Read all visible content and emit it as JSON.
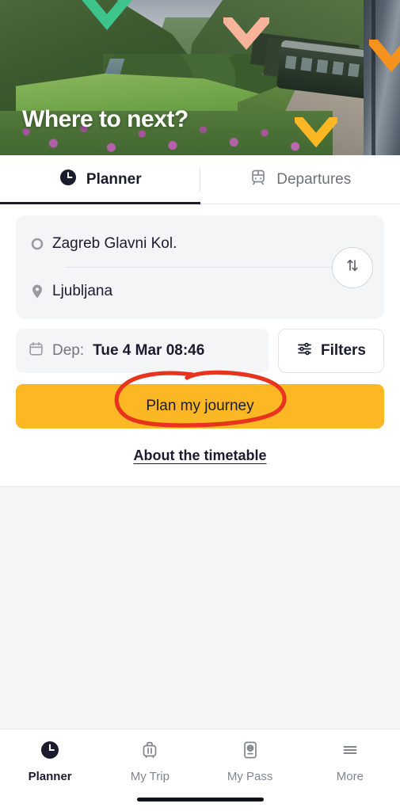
{
  "hero": {
    "title": "Where to next?",
    "chevrons": [
      {
        "name": "chevron-green",
        "color": "#3DC48A"
      },
      {
        "name": "chevron-salmon",
        "color": "#F7B49B"
      },
      {
        "name": "chevron-orange",
        "color": "#F6921E"
      },
      {
        "name": "chevron-yellow",
        "color": "#FBB724"
      }
    ]
  },
  "tabs": {
    "planner": {
      "label": "Planner",
      "icon": "clock-icon",
      "active": true
    },
    "departures": {
      "label": "Departures",
      "icon": "train-icon",
      "active": false
    }
  },
  "planner": {
    "origin": {
      "value": "Zagreb Glavni Kol.",
      "icon": "circle-origin-icon"
    },
    "destination": {
      "value": "Ljubljana",
      "icon": "map-pin-icon"
    },
    "swap": {
      "icon": "swap-vertical-icon"
    },
    "date": {
      "prefix": "Dep:",
      "value": "Tue 4 Mar 08:46",
      "icon": "calendar-icon"
    },
    "filters": {
      "label": "Filters",
      "icon": "sliders-icon"
    },
    "cta": {
      "label": "Plan my journey",
      "color": "#FBB724"
    },
    "about_link": {
      "label": "About the timetable"
    }
  },
  "annotation": {
    "shape": "hand-drawn-ellipse",
    "color": "#E8341F",
    "target": "Plan my journey"
  },
  "bottom_nav": [
    {
      "label": "Planner",
      "icon": "clock-icon",
      "active": true
    },
    {
      "label": "My Trip",
      "icon": "suitcase-icon",
      "active": false
    },
    {
      "label": "My Pass",
      "icon": "passport-icon",
      "active": false
    },
    {
      "label": "More",
      "icon": "hamburger-icon",
      "active": false
    }
  ],
  "colors": {
    "accent_yellow": "#FBB724",
    "dark_navy": "#1C1B2E",
    "muted_gray": "#83858D",
    "panel_gray": "#F4F5F7",
    "page_gray": "#F5F5F6"
  }
}
